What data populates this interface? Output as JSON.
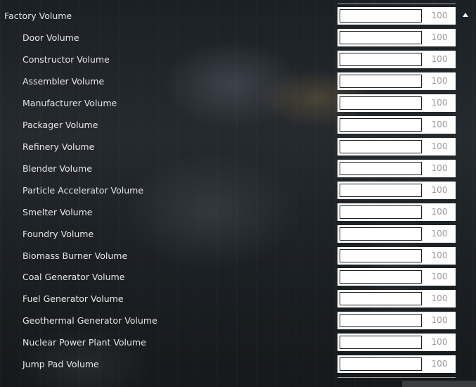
{
  "settings": {
    "group": {
      "label": "Factory Volume",
      "value": "100",
      "level": 1.0
    },
    "items": [
      {
        "label": "Door Volume",
        "value": "100",
        "level": 1.0
      },
      {
        "label": "Constructor Volume",
        "value": "100",
        "level": 1.0
      },
      {
        "label": "Assembler Volume",
        "value": "100",
        "level": 1.0
      },
      {
        "label": "Manufacturer Volume",
        "value": "100",
        "level": 1.0
      },
      {
        "label": "Packager Volume",
        "value": "100",
        "level": 1.0
      },
      {
        "label": "Refinery Volume",
        "value": "100",
        "level": 1.0
      },
      {
        "label": "Blender Volume",
        "value": "100",
        "level": 1.0
      },
      {
        "label": "Particle Accelerator Volume",
        "value": "100",
        "level": 1.0
      },
      {
        "label": "Smelter Volume",
        "value": "100",
        "level": 1.0
      },
      {
        "label": "Foundry Volume",
        "value": "100",
        "level": 1.0
      },
      {
        "label": "Biomass Burner Volume",
        "value": "100",
        "level": 1.0
      },
      {
        "label": "Coal Generator Volume",
        "value": "100",
        "level": 1.0
      },
      {
        "label": "Fuel Generator Volume",
        "value": "100",
        "level": 1.0
      },
      {
        "label": "Geothermal Generator Volume",
        "value": "100",
        "level": 1.0
      },
      {
        "label": "Nuclear Power Plant Volume",
        "value": "100",
        "level": 1.0
      },
      {
        "label": "Jump Pad Volume",
        "value": "100",
        "level": 1.0
      }
    ]
  },
  "icons": {
    "collapse": "collapse-triangle-icon"
  },
  "colors": {
    "text": "#e6e6e6",
    "slider": "#ffffff",
    "value_text": "#9a9a9a"
  }
}
